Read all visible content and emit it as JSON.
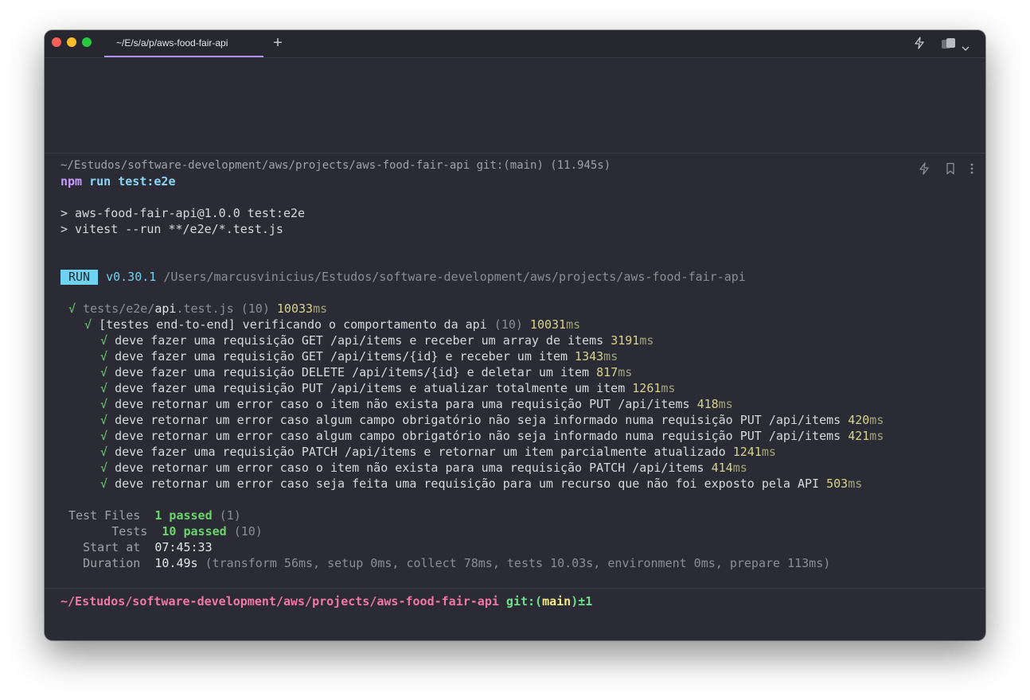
{
  "tab": {
    "title": "~/E/s/a/p/aws-food-fair-api"
  },
  "block": {
    "header": "~/Estudos/software-development/aws/projects/aws-food-fair-api git:(main) (11.945s)",
    "command": {
      "bin": "npm",
      "args": "run test:e2e"
    },
    "script_lines": [
      "> aws-food-fair-api@1.0.0 test:e2e",
      "> vitest --run **/e2e/*.test.js"
    ],
    "run": {
      "badge": "RUN",
      "version": "v0.30.1",
      "path": "/Users/marcusvinicius/Estudos/software-development/aws/projects/aws-food-fair-api"
    },
    "file": {
      "check": "√",
      "dir": "tests/e2e/",
      "name": "api",
      "ext": ".test.js",
      "count": "(10)",
      "time": "10033",
      "unit": "ms"
    },
    "suite": {
      "check": "√",
      "name": "[testes end-to-end] verificando o comportamento da api",
      "count": "(10)",
      "time": "10031",
      "unit": "ms"
    },
    "tests": [
      {
        "check": "√",
        "name": "deve fazer uma requisição GET /api/items e receber um array de items",
        "time": "3191",
        "unit": "ms"
      },
      {
        "check": "√",
        "name": "deve fazer uma requisição GET /api/items/{id} e receber um item",
        "time": "1343",
        "unit": "ms"
      },
      {
        "check": "√",
        "name": "deve fazer uma requisição DELETE /api/items/{id} e deletar um item",
        "time": "817",
        "unit": "ms"
      },
      {
        "check": "√",
        "name": "deve fazer uma requisição PUT /api/items e atualizar totalmente um item",
        "time": "1261",
        "unit": "ms"
      },
      {
        "check": "√",
        "name": "deve retornar um error caso o item não exista para uma requisição PUT /api/items",
        "time": "418",
        "unit": "ms"
      },
      {
        "check": "√",
        "name": "deve retornar um error caso algum campo obrigatório não seja informado numa requisição PUT /api/items",
        "time": "420",
        "unit": "ms"
      },
      {
        "check": "√",
        "name": "deve retornar um error caso algum campo obrigatório não seja informado numa requisição PUT /api/items",
        "time": "421",
        "unit": "ms"
      },
      {
        "check": "√",
        "name": "deve fazer uma requisição PATCH /api/items e retornar um item parcialmente atualizado",
        "time": "1241",
        "unit": "ms"
      },
      {
        "check": "√",
        "name": "deve retornar um error caso o item não exista para uma requisição PATCH /api/items",
        "time": "414",
        "unit": "ms"
      },
      {
        "check": "√",
        "name": "deve retornar um error caso seja feita uma requisição para um recurso que não foi exposto pela API",
        "time": "503",
        "unit": "ms"
      }
    ],
    "summary": {
      "test_files": {
        "label": "Test Files",
        "passed": "1 passed",
        "total": "(1)"
      },
      "tests": {
        "label": "Tests",
        "passed": "10 passed",
        "total": "(10)"
      },
      "start": {
        "label": "Start at",
        "value": "07:45:33"
      },
      "duration": {
        "label": "Duration",
        "value": "10.49s",
        "detail": "(transform 56ms, setup 0ms, collect 78ms, tests 10.03s, environment 0ms, prepare 113ms)"
      }
    }
  },
  "prompt": {
    "path": "~/Estudos/software-development/aws/projects/aws-food-fair-api",
    "git_prefix": "git:(",
    "branch": "main",
    "git_suffix": ")",
    "dirty": "±1"
  },
  "colors": {
    "terminal_bg": "#2a2b34",
    "tab_accent": "#b48ef3",
    "pass_green": "#6bd46b",
    "prompt_pink": "#f277a8",
    "run_badge": "#6fd2f0"
  }
}
